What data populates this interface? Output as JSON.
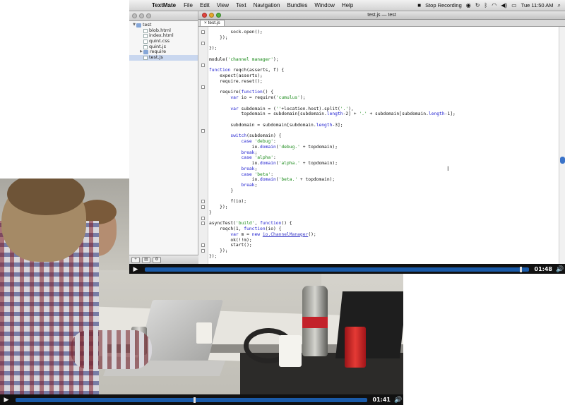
{
  "menubar": {
    "apple_icon": "apple-icon",
    "app_name": "TextMate",
    "items": [
      "File",
      "Edit",
      "View",
      "Text",
      "Navigation",
      "Bundles",
      "Window",
      "Help"
    ],
    "recording_label": "Stop Recording",
    "clock": "Tue 11:50 AM"
  },
  "drawer": {
    "tree": [
      {
        "label": "test",
        "kind": "folder",
        "expanded": true,
        "depth": 0
      },
      {
        "label": "blob.html",
        "kind": "file",
        "depth": 1
      },
      {
        "label": "index.html",
        "kind": "file",
        "depth": 1
      },
      {
        "label": "quint.css",
        "kind": "file",
        "depth": 1
      },
      {
        "label": "quint.js",
        "kind": "file",
        "depth": 1
      },
      {
        "label": "require",
        "kind": "folder",
        "expanded": false,
        "depth": 1
      },
      {
        "label": "test.js",
        "kind": "file",
        "depth": 1,
        "selected": true
      }
    ]
  },
  "editor": {
    "window_title": "test.js — test",
    "tab_label": "test.js",
    "code_lines": [
      [
        {
          "t": "        sock.open();"
        }
      ],
      [
        {
          "t": "    });"
        }
      ],
      [
        {
          "t": ""
        }
      ],
      [
        {
          "t": "});"
        }
      ],
      [
        {
          "t": ""
        }
      ],
      [
        {
          "t": "module("
        },
        {
          "t": "'channel manager'",
          "c": "str"
        },
        {
          "t": ");"
        }
      ],
      [
        {
          "t": ""
        }
      ],
      [
        {
          "t": "function",
          "c": "kw"
        },
        {
          "t": " reqch(asserts, f) {"
        }
      ],
      [
        {
          "t": "    expect(asserts);"
        }
      ],
      [
        {
          "t": "    require.reset();"
        }
      ],
      [
        {
          "t": ""
        }
      ],
      [
        {
          "t": "    require("
        },
        {
          "t": "function",
          "c": "kw"
        },
        {
          "t": "() {"
        }
      ],
      [
        {
          "t": "        "
        },
        {
          "t": "var",
          "c": "kw"
        },
        {
          "t": " io = require("
        },
        {
          "t": "'cumulus'",
          "c": "str"
        },
        {
          "t": ");"
        }
      ],
      [
        {
          "t": ""
        }
      ],
      [
        {
          "t": "        "
        },
        {
          "t": "var",
          "c": "kw"
        },
        {
          "t": " subdomain = ("
        },
        {
          "t": "''",
          "c": "str"
        },
        {
          "t": "+location.host).split("
        },
        {
          "t": "'.'",
          "c": "str"
        },
        {
          "t": "),"
        }
      ],
      [
        {
          "t": "            topdomain = subdomain[subdomain."
        },
        {
          "t": "length",
          "c": "kw"
        },
        {
          "t": "-2] + "
        },
        {
          "t": "'.'",
          "c": "str"
        },
        {
          "t": " + subdomain[subdomain."
        },
        {
          "t": "length",
          "c": "kw"
        },
        {
          "t": "-1];"
        }
      ],
      [
        {
          "t": ""
        }
      ],
      [
        {
          "t": "        subdomain = subdomain[subdomain."
        },
        {
          "t": "length",
          "c": "kw"
        },
        {
          "t": "-3];"
        }
      ],
      [
        {
          "t": ""
        }
      ],
      [
        {
          "t": "        "
        },
        {
          "t": "switch",
          "c": "kw"
        },
        {
          "t": "(subdomain) {"
        }
      ],
      [
        {
          "t": "            "
        },
        {
          "t": "case",
          "c": "kw"
        },
        {
          "t": " "
        },
        {
          "t": "'debug'",
          "c": "str"
        },
        {
          "t": ":"
        }
      ],
      [
        {
          "t": "                io."
        },
        {
          "t": "domain",
          "c": "kw"
        },
        {
          "t": "("
        },
        {
          "t": "'debug.'",
          "c": "str"
        },
        {
          "t": " + topdomain);"
        }
      ],
      [
        {
          "t": "            "
        },
        {
          "t": "break",
          "c": "kw"
        },
        {
          "t": ";"
        }
      ],
      [
        {
          "t": "            "
        },
        {
          "t": "case",
          "c": "kw"
        },
        {
          "t": " "
        },
        {
          "t": "'alpha'",
          "c": "str"
        },
        {
          "t": ":"
        }
      ],
      [
        {
          "t": "                io."
        },
        {
          "t": "domain",
          "c": "kw"
        },
        {
          "t": "("
        },
        {
          "t": "'alpha.'",
          "c": "str"
        },
        {
          "t": " + topdomain);"
        }
      ],
      [
        {
          "t": "            "
        },
        {
          "t": "break",
          "c": "kw"
        },
        {
          "t": ";"
        }
      ],
      [
        {
          "t": "            "
        },
        {
          "t": "case",
          "c": "kw"
        },
        {
          "t": " "
        },
        {
          "t": "'beta'",
          "c": "str"
        },
        {
          "t": ":"
        }
      ],
      [
        {
          "t": "                io."
        },
        {
          "t": "domain",
          "c": "kw"
        },
        {
          "t": "("
        },
        {
          "t": "'beta.'",
          "c": "str"
        },
        {
          "t": " + topdomain);"
        }
      ],
      [
        {
          "t": "            "
        },
        {
          "t": "break",
          "c": "kw"
        },
        {
          "t": ";"
        }
      ],
      [
        {
          "t": "        }"
        }
      ],
      [
        {
          "t": ""
        }
      ],
      [
        {
          "t": "        f(io);"
        }
      ],
      [
        {
          "t": "    });"
        }
      ],
      [
        {
          "t": "}"
        }
      ],
      [
        {
          "t": ""
        }
      ],
      [
        {
          "t": "asyncTest("
        },
        {
          "t": "'build'",
          "c": "str"
        },
        {
          "t": ", "
        },
        {
          "t": "function",
          "c": "kw"
        },
        {
          "t": "() {"
        }
      ],
      [
        {
          "t": "    reqch(1, "
        },
        {
          "t": "function",
          "c": "kw"
        },
        {
          "t": "(io) {"
        }
      ],
      [
        {
          "t": "        "
        },
        {
          "t": "var",
          "c": "kw"
        },
        {
          "t": " m = "
        },
        {
          "t": "new",
          "c": "kw"
        },
        {
          "t": " "
        },
        {
          "t": "io.ChannelManager",
          "c": "hl"
        },
        {
          "t": "();"
        }
      ],
      [
        {
          "t": "        ok(!!m);"
        }
      ],
      [
        {
          "t": "        start();"
        }
      ],
      [
        {
          "t": "    });"
        }
      ],
      [
        {
          "t": "});"
        }
      ]
    ],
    "fold_marker_lines": [
      1,
      3,
      7,
      11,
      19,
      32,
      33,
      35,
      36,
      40,
      41
    ]
  },
  "top_video": {
    "time": "01:48",
    "progress": 0.98,
    "play_icon": "play-icon",
    "volume_icon": "volume-icon"
  },
  "bottom_video": {
    "time": "01:41",
    "progress": 0.51,
    "play_icon": "play-icon",
    "volume_icon": "volume-icon"
  }
}
